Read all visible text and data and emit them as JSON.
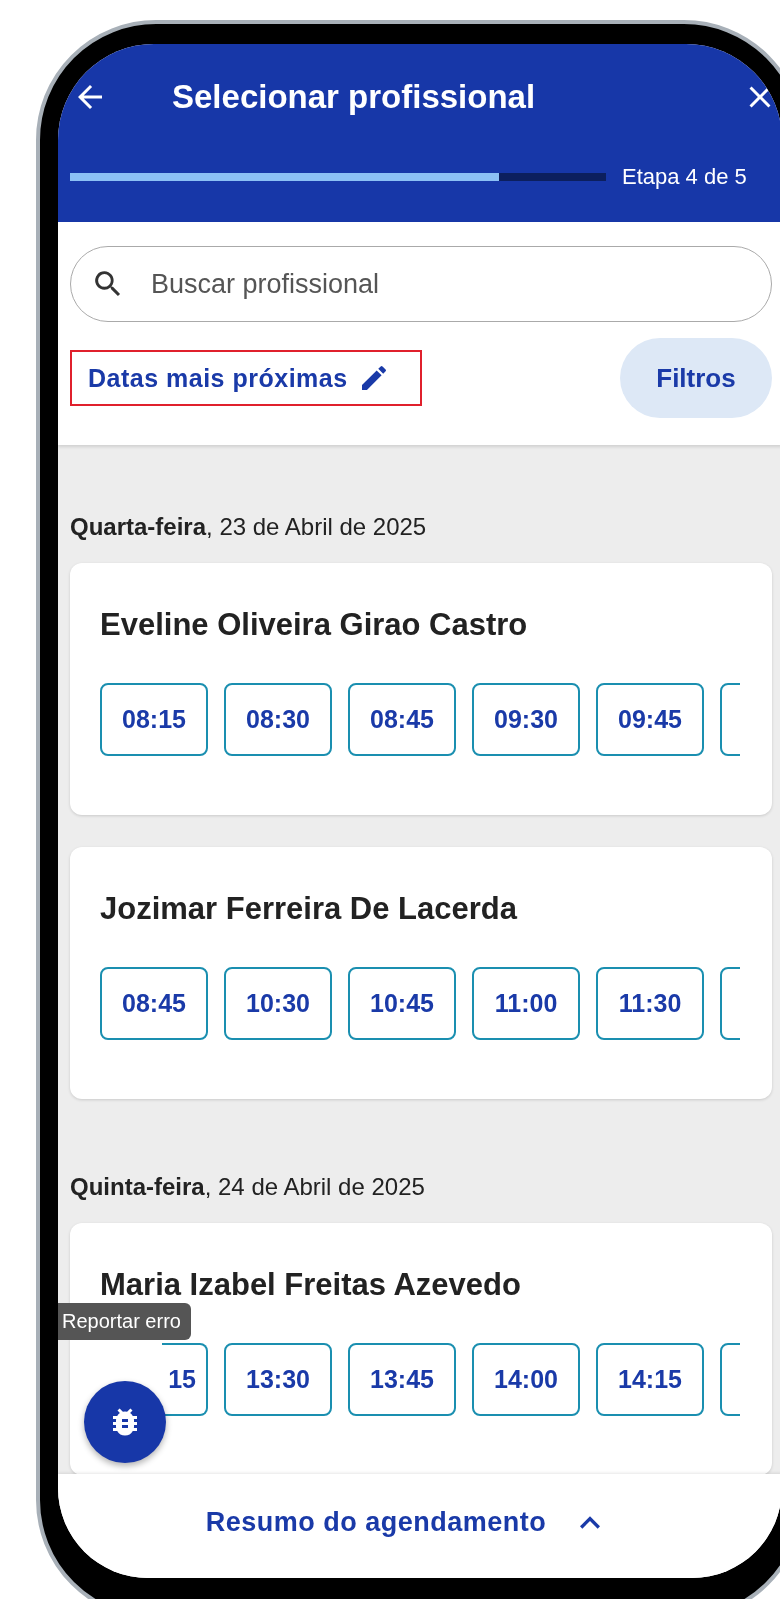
{
  "header": {
    "title": "Selecionar profissional",
    "progress": {
      "level": 0.8
    },
    "step_label": "Etapa 4 de 5"
  },
  "search": {
    "placeholder": "Buscar profissional"
  },
  "sort_link": {
    "label": "Datas mais próximas",
    "highlighted": true
  },
  "filters_button": {
    "label": "Filtros"
  },
  "date_groups": [
    {
      "date_label": "**Quarta-feira**, 23 de Abril de 2025",
      "professionals": [
        {
          "name": "Eveline Oliveira Girao Castro",
          "more_times": true,
          "times": [
            {
              "label": "08:15",
              "kind": "full"
            },
            {
              "label": "08:30",
              "kind": "full"
            },
            {
              "label": "08:45",
              "kind": "full"
            },
            {
              "label": "09:30",
              "kind": "full"
            },
            {
              "label": "09:45",
              "kind": "full"
            }
          ]
        },
        {
          "name": "Jozimar Ferreira De Lacerda",
          "more_times": true,
          "times": [
            {
              "label": "08:45",
              "kind": "full"
            },
            {
              "label": "10:30",
              "kind": "full"
            },
            {
              "label": "10:45",
              "kind": "full"
            },
            {
              "label": "11:00",
              "kind": "full"
            },
            {
              "label": "11:30",
              "kind": "full"
            }
          ]
        }
      ]
    },
    {
      "date_label": "**Quinta-feira**, 24 de Abril de 2025",
      "professionals": [
        {
          "name": "Maria Izabel Freitas Azevedo",
          "more_times": true,
          "times": [
            {
              "label": "15",
              "kind": "covered"
            },
            {
              "label": "13:30",
              "kind": "full"
            },
            {
              "label": "13:45",
              "kind": "full"
            },
            {
              "label": "14:00",
              "kind": "full"
            },
            {
              "label": "14:15",
              "kind": "full"
            }
          ]
        }
      ]
    }
  ],
  "report_tooltip": "Reportar erro",
  "summary_bar": {
    "label": "Resumo do agendamento",
    "expanded": false
  }
}
